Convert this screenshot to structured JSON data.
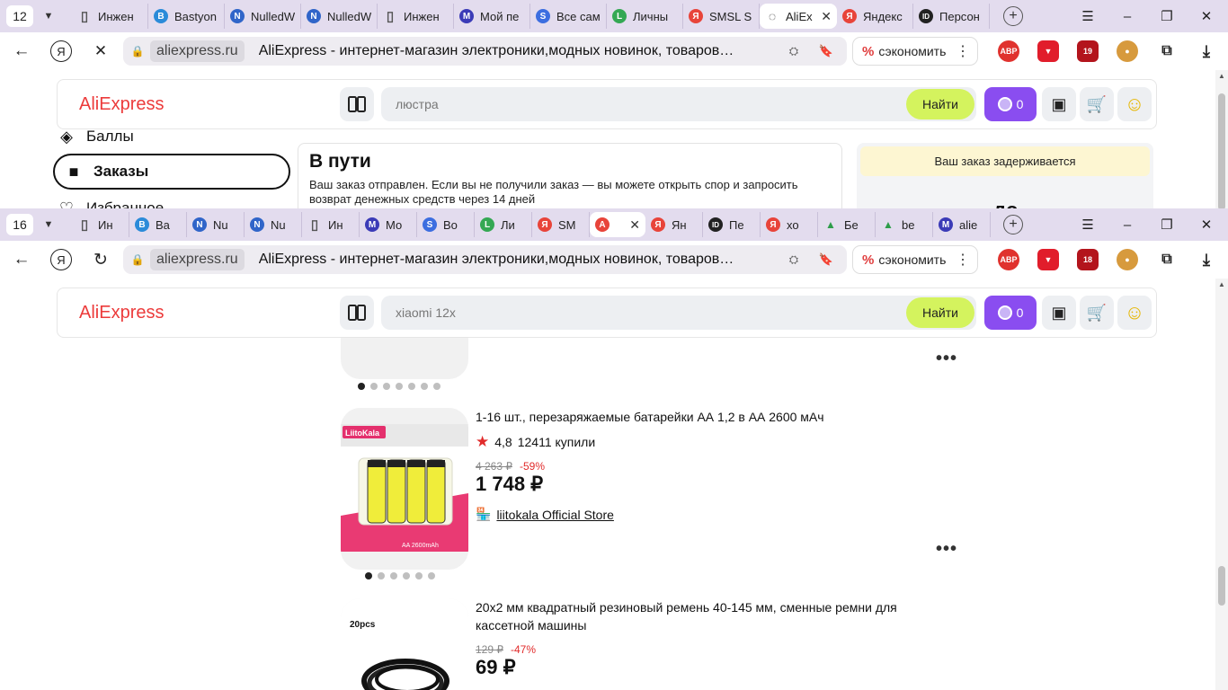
{
  "win1": {
    "tab_count": "12",
    "tabs": [
      {
        "label": "Инжен",
        "fav": "doc",
        "color": "#555555"
      },
      {
        "label": "Bastyon",
        "fav": "B",
        "color": "#2b8bd9"
      },
      {
        "label": "NulledW",
        "fav": "N",
        "color": "#3065c9"
      },
      {
        "label": "NulledW",
        "fav": "N",
        "color": "#3065c9"
      },
      {
        "label": "Инжен",
        "fav": "doc",
        "color": "#555555"
      },
      {
        "label": "Мой пе",
        "fav": "M",
        "color": "#3b3bb7"
      },
      {
        "label": "Все сам",
        "fav": "S",
        "color": "#3c6ee0"
      },
      {
        "label": "Личны",
        "fav": "L",
        "color": "#34a853"
      },
      {
        "label": "SMSL S",
        "fav": "Я",
        "color": "#e8443a"
      },
      {
        "label": "AliEx",
        "fav": "load",
        "color": "#222222"
      },
      {
        "label": "Яндекс",
        "fav": "Я",
        "color": "#e8443a"
      },
      {
        "label": "Персон",
        "fav": "ID",
        "color": "#222222"
      }
    ],
    "address": {
      "domain": "aliexpress.ru",
      "title": "AliExpress - интернет-магазин электроники,модных новинок, товаров…"
    },
    "save_label": "сэкономить",
    "ext_badge": "19",
    "search_value": "люстра",
    "sidebar": [
      {
        "label": "Баллы",
        "icon": "points-icon"
      },
      {
        "label": "Заказы",
        "icon": "box-icon"
      },
      {
        "label": "Избранное",
        "icon": "heart-icon"
      }
    ],
    "order": {
      "heading": "В пути",
      "text": "Ваш заказ отправлен. Если вы не получили заказ — вы можете открыть спор и запросить возврат денежных средств через 14 дней"
    },
    "delay": {
      "banner": "Ваш заказ задерживается",
      "big": "до"
    }
  },
  "win2": {
    "tab_count": "16",
    "tabs": [
      {
        "label": "Ин",
        "fav": "doc",
        "color": "#555555"
      },
      {
        "label": "Ba",
        "fav": "B",
        "color": "#2b8bd9"
      },
      {
        "label": "Nu",
        "fav": "N",
        "color": "#3065c9"
      },
      {
        "label": "Nu",
        "fav": "N",
        "color": "#3065c9"
      },
      {
        "label": "Ин",
        "fav": "doc",
        "color": "#555555"
      },
      {
        "label": "Мо",
        "fav": "M",
        "color": "#3b3bb7"
      },
      {
        "label": "Во",
        "fav": "S",
        "color": "#3c6ee0"
      },
      {
        "label": "Ли",
        "fav": "L",
        "color": "#34a853"
      },
      {
        "label": "SM",
        "fav": "Я",
        "color": "#e8443a"
      },
      {
        "label": "",
        "fav": "A",
        "color": "#e8443a"
      },
      {
        "label": "Ян",
        "fav": "Я",
        "color": "#e8443a"
      },
      {
        "label": "Пе",
        "fav": "ID",
        "color": "#222222"
      },
      {
        "label": "хо",
        "fav": "Я",
        "color": "#e8443a"
      },
      {
        "label": "Бе",
        "fav": "img",
        "color": "#2e9d4a"
      },
      {
        "label": "be",
        "fav": "img",
        "color": "#2e9d4a"
      },
      {
        "label": "alie",
        "fav": "M",
        "color": "#3b3bb7"
      }
    ],
    "address": {
      "domain": "aliexpress.ru",
      "title": "AliExpress - интернет-магазин электроники,модных новинок, товаров…"
    },
    "save_label": "сэкономить",
    "ext_badge": "18",
    "search_value": "xiaomi 12x",
    "products": [
      {
        "title": "1-16 шт., перезаряжаемые батарейки АА 1,2 в АА 2600 мАч",
        "rating": "4,8",
        "sold": "12411 купили",
        "old_price": "4 263 ₽",
        "discount": "-59%",
        "price": "1 748 ₽",
        "store": "liitokala Official Store",
        "brand": "LiitoKala",
        "pack_label": "AA 2600mAh"
      },
      {
        "title": "20x2 мм квадратный резиновый ремень 40-145 мм, сменные ремни для кассетной машины",
        "old_price": "129 ₽",
        "discount": "-47%",
        "price": "69 ₽",
        "pack_label": "20pcs"
      }
    ]
  },
  "common": {
    "logo": "AliExpress",
    "find_label": "Найти",
    "coins": "0"
  }
}
